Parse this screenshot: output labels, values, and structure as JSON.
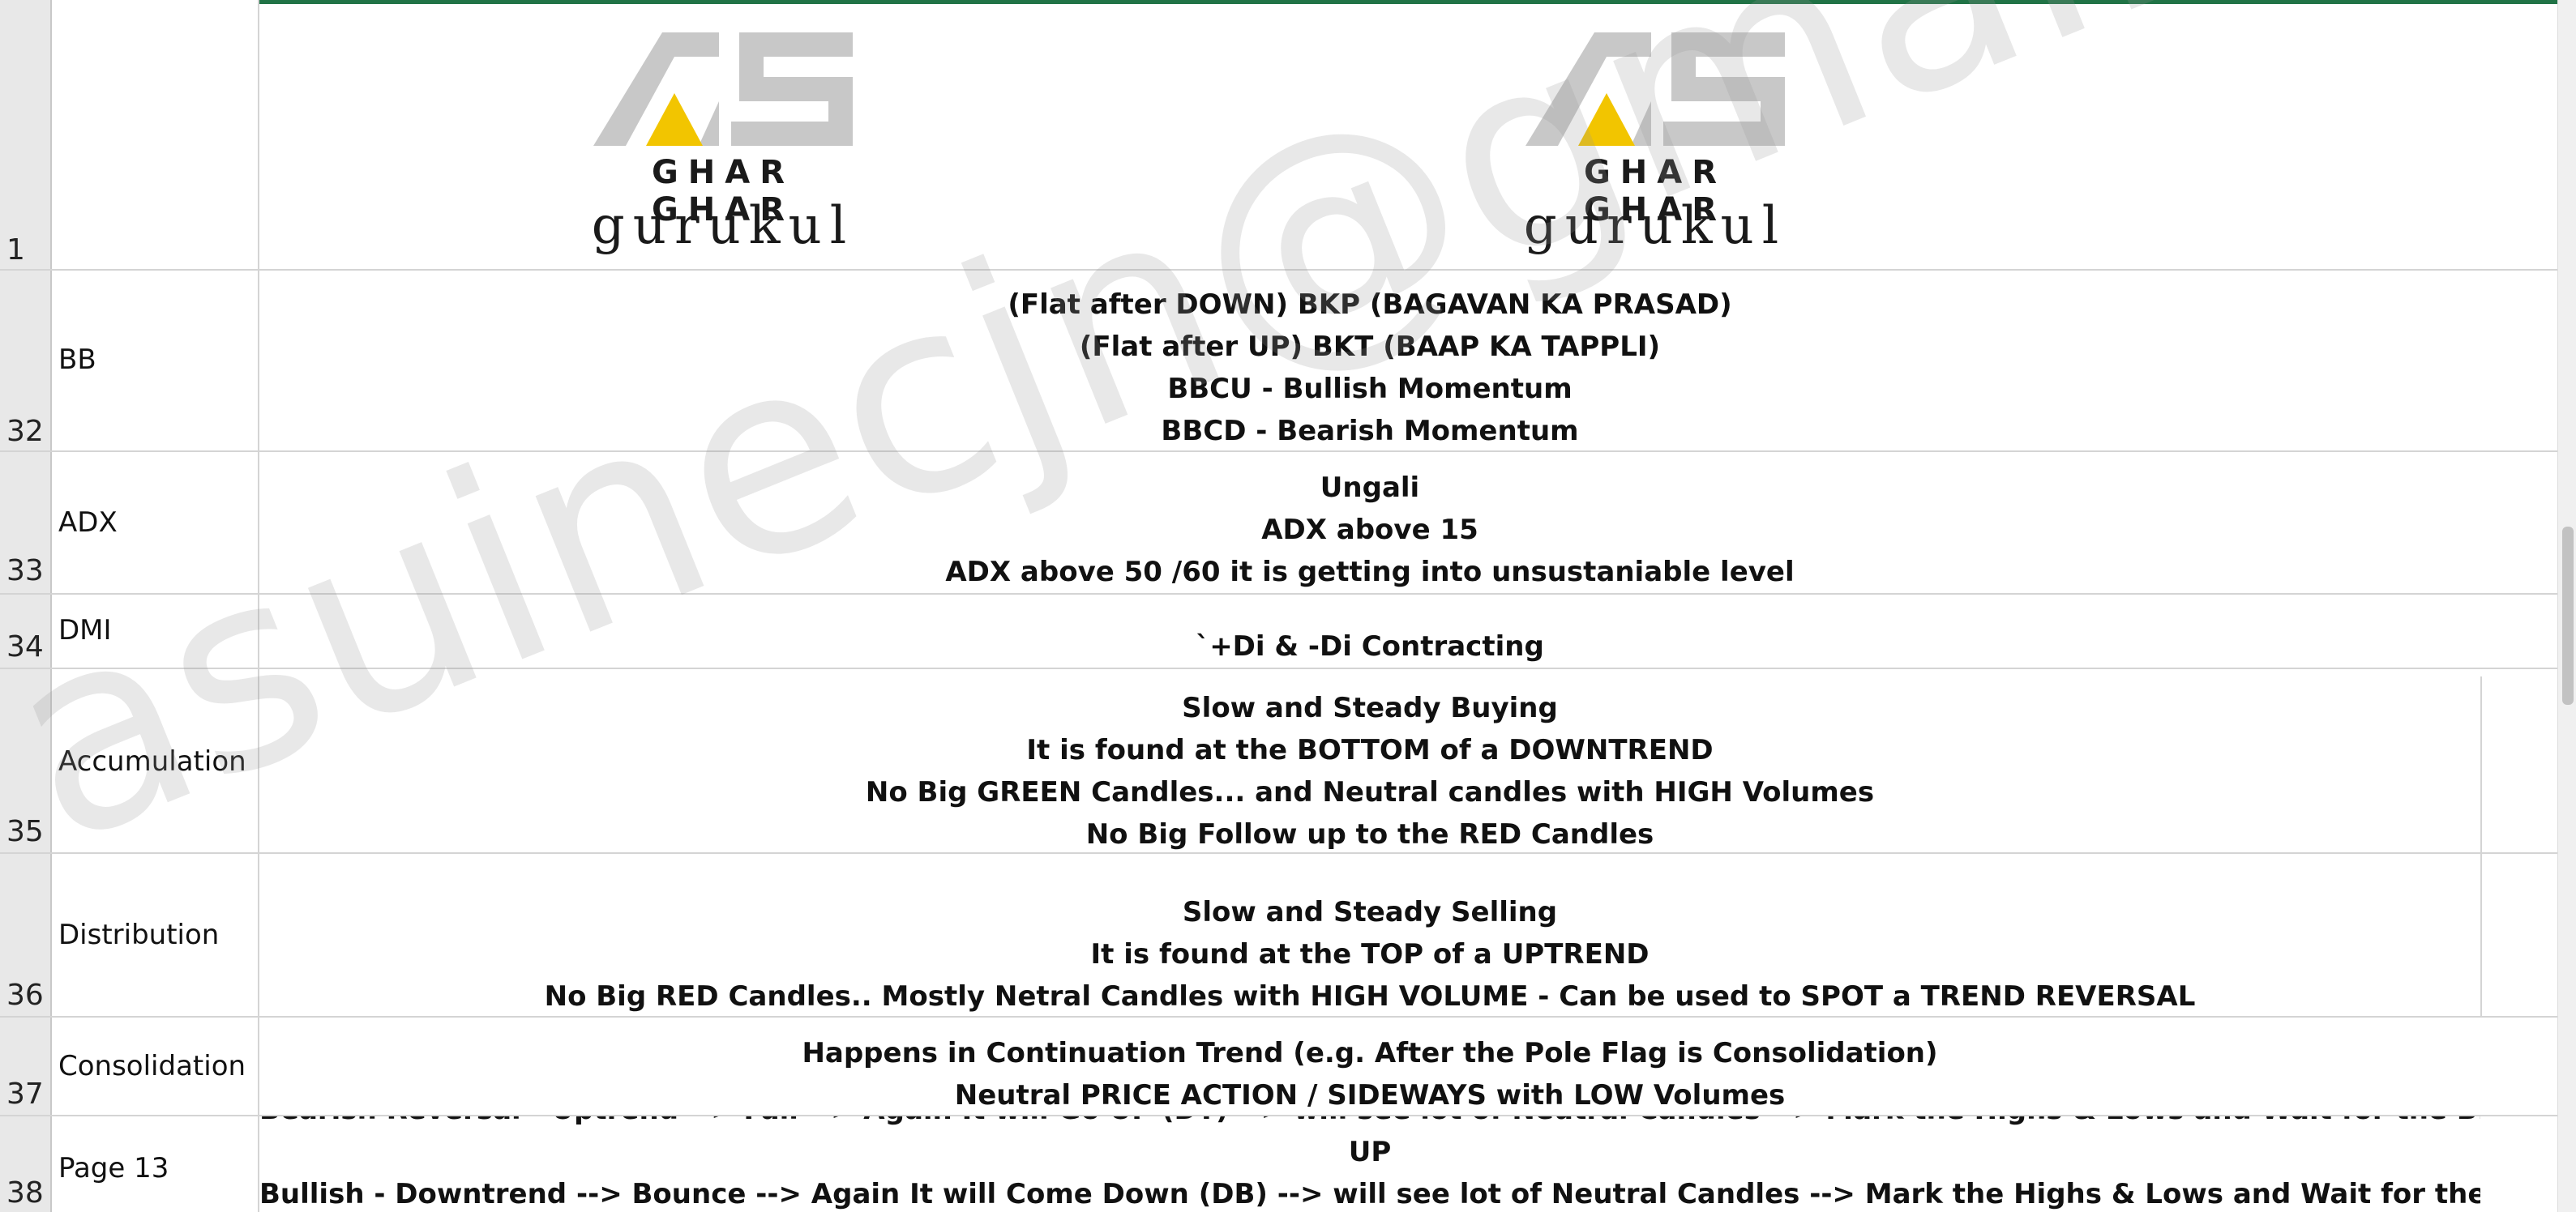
{
  "logos": [
    {
      "line1": "GHAR GHAR",
      "line2": "gurukul",
      "mark": "AS"
    },
    {
      "line1": "GHAR GHAR",
      "line2": "gurukul",
      "mark": "AS"
    }
  ],
  "watermark": "asuinecjn@gmail.com",
  "rows": [
    {
      "num": "1",
      "label": "",
      "lines": []
    },
    {
      "num": "32",
      "label": "BB",
      "lines": [
        "(Flat after DOWN) BKP (BAGAVAN KA PRASAD)",
        "(Flat after UP) BKT (BAAP KA TAPPLI)",
        "BBCU - Bullish Momentum",
        "BBCD - Bearish Momentum"
      ]
    },
    {
      "num": "33",
      "label": "ADX",
      "lines": [
        "Ungali",
        "ADX above 15",
        "ADX above 50 /60 it is getting into unsustaniable level"
      ]
    },
    {
      "num": "34",
      "label": "DMI",
      "lines": [
        "`+Di & -Di Contracting"
      ]
    },
    {
      "num": "35",
      "label": "Accumulation",
      "lines": [
        "Slow and Steady Buying",
        "It is found at the BOTTOM of a DOWNTREND",
        "No Big GREEN Candles... and Neutral candles with HIGH Volumes",
        "No Big Follow up to the RED Candles"
      ]
    },
    {
      "num": "36",
      "label": "Distribution",
      "lines": [
        "Slow and Steady Selling",
        "It is found at the TOP of a UPTREND",
        "No Big RED Candles.. Mostly Netral Candles with HIGH VOLUME - Can be used to SPOT a TREND REVERSAL"
      ]
    },
    {
      "num": "37",
      "label": "Consolidation",
      "lines": [
        "Happens in Continuation Trend (e.g. After the Pole Flag is Consolidation)",
        "Neutral PRICE ACTION / SIDEWAYS with LOW Volumes"
      ]
    },
    {
      "num": "38",
      "label": "Page 13",
      "lines": [
        "Bearish Reversal - Uptrend --> Fall --> Again It will Go UP (DT) --> will see lot of Neutral Candles --> Mark the Highs & Lows and Wait for the BD Confirmation / Follow",
        "UP",
        "Bullish - Downtrend --> Bounce --> Again It will Come Down (DB) --> will see lot of Neutral Candles --> Mark the Highs & Lows and Wait for the BO & Confirmation /"
      ]
    }
  ]
}
